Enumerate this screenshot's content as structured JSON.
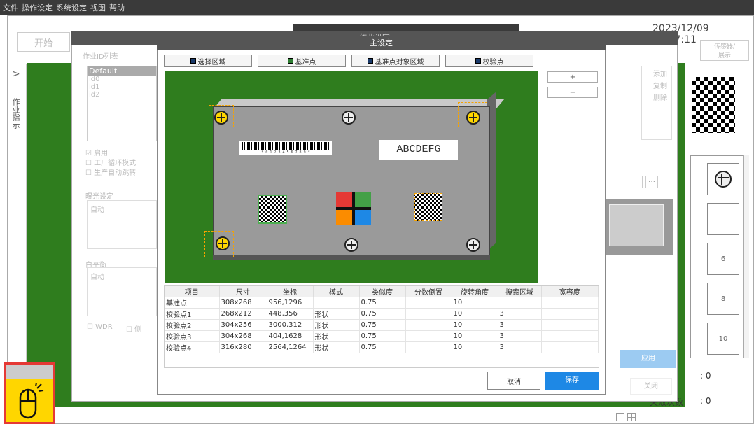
{
  "menu": [
    "文件",
    "操作设定",
    "系统设定",
    "视图",
    "帮助"
  ],
  "datetime": "2023/12/09 11:47:11",
  "start_label": "开始",
  "sensor_label": "传感器/\n展示",
  "side_tab": "作业指示",
  "side_chevron": ">",
  "bg_dialog": {
    "title": "作业设定",
    "list_label": "作业ID列表",
    "ids": [
      "Default",
      "id0",
      "id1",
      "id2"
    ],
    "actions": [
      "添加",
      "复制",
      "删除"
    ],
    "checks": [
      "启用",
      "工厂循环模式",
      "生产自动跳转"
    ],
    "exposure_label": "曝光设定",
    "exposure_value": "自动",
    "wb_label": "白平衡",
    "wb_value": "自动",
    "wdr": "WDR",
    "other": "侧",
    "apply": "应用",
    "close": "关闭"
  },
  "counts": [
    {
      "label": "",
      "value": ": 0"
    },
    {
      "label": "失败次数",
      "value": ": 0"
    }
  ],
  "slot_numbers": [
    "6",
    "8",
    "10"
  ],
  "dialog": {
    "title": "主设定",
    "tabs": [
      "选择区域",
      "基准点",
      "基准点对象区域",
      "校验点"
    ],
    "plus": "+",
    "minus": "−",
    "barcode_text": "* 0 1 2 3 4 5 6 7 8 9 *",
    "label_text": "ABCDEFG",
    "columns": [
      "项目",
      "尺寸",
      "坐标",
      "模式",
      "类似度",
      "分数倒置",
      "旋转角度",
      "搜索区域",
      "宽容度"
    ],
    "rows": [
      [
        "基准点",
        "308x268",
        "956,1296",
        "",
        "0.75",
        "",
        "10",
        "",
        ""
      ],
      [
        "校验点1",
        "268x212",
        "448,356",
        "形状",
        "0.75",
        "",
        "10",
        "3",
        ""
      ],
      [
        "校验点2",
        "304x256",
        "3000,312",
        "形状",
        "0.75",
        "",
        "10",
        "3",
        ""
      ],
      [
        "校验点3",
        "304x268",
        "404,1628",
        "形状",
        "0.75",
        "",
        "10",
        "3",
        ""
      ],
      [
        "校验点4",
        "316x280",
        "2564,1264",
        "形状",
        "0.75",
        "",
        "10",
        "3",
        ""
      ]
    ],
    "cancel": "取消",
    "save": "保存"
  },
  "colors": {
    "accent": "#1e88e5",
    "green_bg": "#2f7d1e",
    "highlight": "#e53935",
    "cursor_bg": "#ffd600"
  },
  "icons": [
    "mouse-cursor-icon",
    "checkbox-icon"
  ]
}
